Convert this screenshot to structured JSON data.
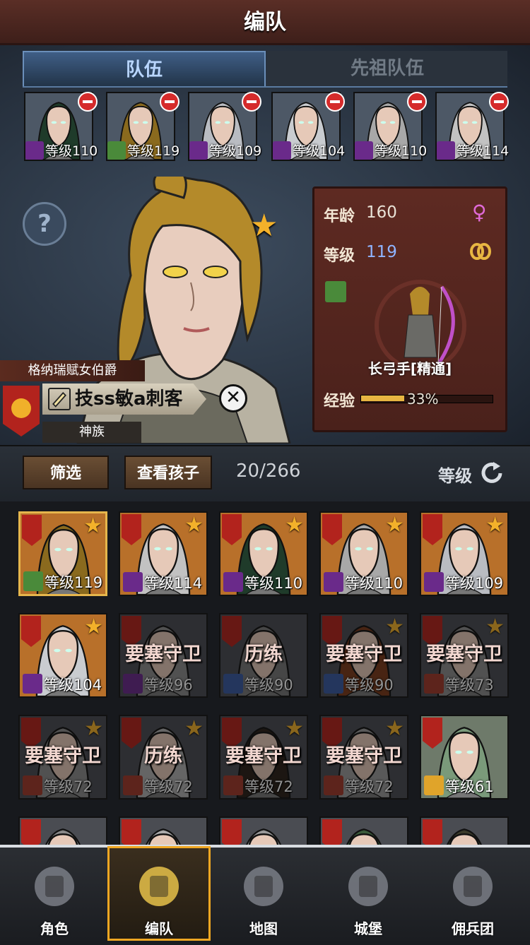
{
  "title": "编队",
  "tabs": [
    {
      "label": "队伍",
      "active": true
    },
    {
      "label": "先祖队伍",
      "active": false
    }
  ],
  "team_slots": [
    {
      "level": "等级110",
      "class_icon": "staff-icon",
      "hair": "#1f3b2a"
    },
    {
      "level": "等级119",
      "class_icon": "bow-icon",
      "hair": "#8a6a1e"
    },
    {
      "level": "等级109",
      "class_icon": "staff-icon",
      "hair": "#b9bcc2"
    },
    {
      "level": "等级104",
      "class_icon": "staff-icon",
      "hair": "#c9ccd0"
    },
    {
      "level": "等级110",
      "class_icon": "staff-icon",
      "hair": "#a8a8a8"
    },
    {
      "level": "等级114",
      "class_icon": "staff-icon",
      "hair": "#c2c2c2"
    }
  ],
  "hero": {
    "title": "格纳瑞赋女伯爵",
    "name": "技ss敏a刺客",
    "race": "神族",
    "age_label": "年龄",
    "age": "160",
    "level_label": "等级",
    "level": "119",
    "class_name": "长弓手[精通]",
    "exp_label": "经验",
    "exp_percent": "33%",
    "exp_fraction": 0.33,
    "gender_icon": "female-icon",
    "ring_icon": "rings-icon"
  },
  "filter": {
    "filter_label": "筛选",
    "children_label": "查看孩子",
    "count": "20/266",
    "sort_label": "等级"
  },
  "roster": [
    {
      "text": "等级119",
      "kind": "level",
      "class_icon": "bow-icon",
      "star": true,
      "hair": "#8a6a1e",
      "bg": "#b8702a",
      "selected": true
    },
    {
      "text": "等级114",
      "kind": "level",
      "class_icon": "staff-icon",
      "star": true,
      "hair": "#c2c2c2",
      "bg": "#b8702a"
    },
    {
      "text": "等级110",
      "kind": "level",
      "class_icon": "staff-icon",
      "star": true,
      "hair": "#1f3b2a",
      "bg": "#b8702a"
    },
    {
      "text": "等级110",
      "kind": "level",
      "class_icon": "staff-icon",
      "star": true,
      "hair": "#a8a8a8",
      "bg": "#b8702a"
    },
    {
      "text": "等级109",
      "kind": "level",
      "class_icon": "staff-icon",
      "star": true,
      "hair": "#b9bcc2",
      "bg": "#b8702a"
    },
    {
      "text": "等级104",
      "kind": "level",
      "class_icon": "staff-icon",
      "star": true,
      "hair": "#c9ccd0",
      "bg": "#b8702a"
    },
    {
      "text": "等级96",
      "kind": "level",
      "status": "要塞守卫",
      "class_icon": "staff-icon",
      "star": false,
      "hair": "#8b8b8b",
      "bg": "#4a4c52",
      "dim": true
    },
    {
      "text": "等级90",
      "kind": "level",
      "status": "历练",
      "class_icon": "sword-icon",
      "star": false,
      "hair": "#777",
      "bg": "#4a4c52",
      "dim": true
    },
    {
      "text": "等级90",
      "kind": "level",
      "status": "要塞守卫",
      "class_icon": "sword-icon",
      "star": true,
      "hair": "#7a3a1a",
      "bg": "#4a4c52",
      "dim": true
    },
    {
      "text": "等级73",
      "kind": "level",
      "status": "要塞守卫",
      "class_icon": "wolf-icon",
      "star": true,
      "hair": "#8a8a8a",
      "bg": "#4a4c52",
      "dim": true
    },
    {
      "text": "等级72",
      "kind": "level",
      "status": "要塞守卫",
      "class_icon": "wolf-icon",
      "star": true,
      "hair": "#8a8a8a",
      "bg": "#4a4c52",
      "dim": true
    },
    {
      "text": "等级72",
      "kind": "level",
      "status": "历练",
      "class_icon": "wolf-icon",
      "star": true,
      "hair": "#b0b0b0",
      "bg": "#4a4c52",
      "dim": true
    },
    {
      "text": "等级72",
      "kind": "level",
      "status": "要塞守卫",
      "class_icon": "wolf-icon",
      "star": true,
      "hair": "#2a2018",
      "bg": "#4a4c52",
      "dim": true
    },
    {
      "text": "等级72",
      "kind": "level",
      "status": "要塞守卫",
      "class_icon": "wolf-icon",
      "star": true,
      "hair": "#9a9a9a",
      "bg": "#4a4c52",
      "dim": true
    },
    {
      "text": "等级61",
      "kind": "level",
      "class_icon": "shield-icon",
      "star": false,
      "hair": "#7a9a7a",
      "bg": "#6e7a6a"
    },
    {
      "text": "",
      "kind": "partial",
      "hair": "#888",
      "bg": "#4a4c52"
    },
    {
      "text": "",
      "kind": "partial",
      "hair": "#aaa",
      "bg": "#4a4c52"
    },
    {
      "text": "",
      "kind": "partial",
      "hair": "#999",
      "bg": "#4a4c52"
    },
    {
      "text": "",
      "kind": "partial",
      "hair": "#3a5a3a",
      "bg": "#4a4c52"
    },
    {
      "text": "",
      "kind": "partial",
      "hair": "#3a3a2a",
      "bg": "#4a4c52"
    }
  ],
  "nav": [
    {
      "label": "角色",
      "icon": "knight-icon",
      "active": false
    },
    {
      "label": "编队",
      "icon": "helmet-icon",
      "active": true
    },
    {
      "label": "地图",
      "icon": "compass-icon",
      "active": false
    },
    {
      "label": "城堡",
      "icon": "castle-icon",
      "active": false
    },
    {
      "label": "佣兵团",
      "icon": "mercenary-icon",
      "active": false
    }
  ],
  "colors": {
    "staff_icon_bg": "#6a2a8a",
    "bow_icon_bg": "#4a8a3a",
    "sword_icon_bg": "#3a5aa0",
    "wolf_icon_bg": "#a03a2a",
    "shield_icon_bg": "#e0a42a",
    "accent_gold": "#f0a722",
    "level_blue": "#8fb4ff"
  }
}
